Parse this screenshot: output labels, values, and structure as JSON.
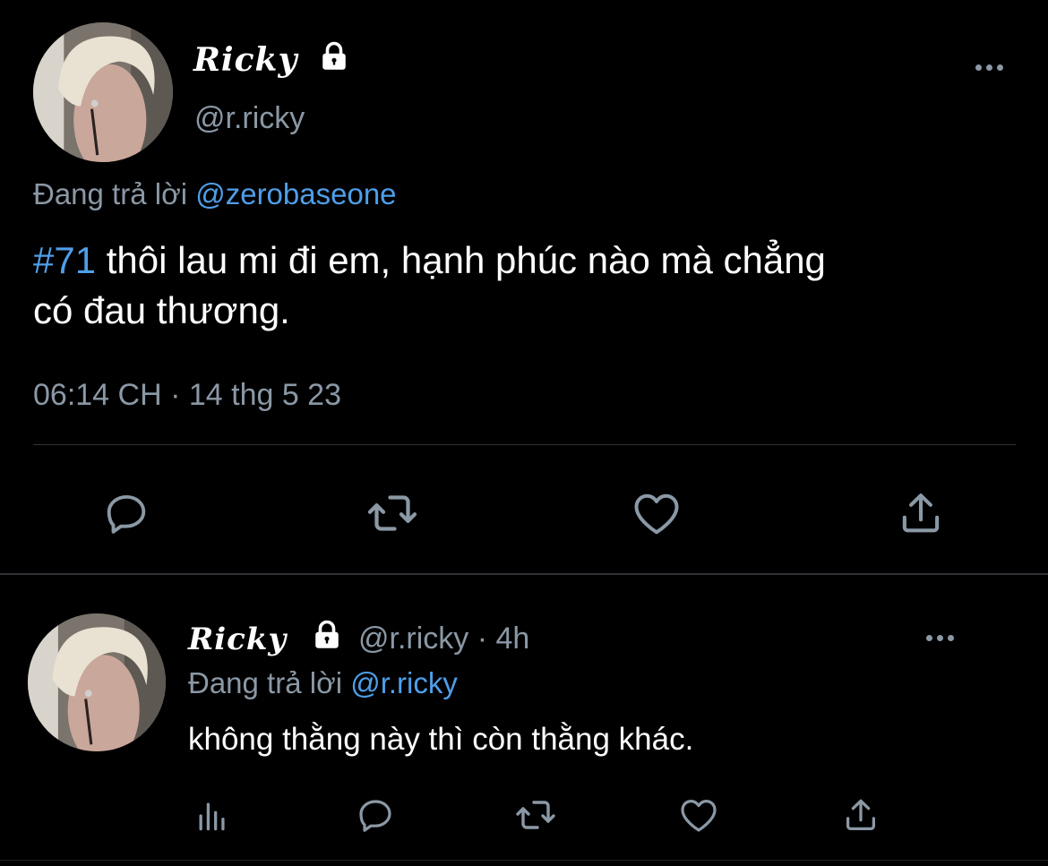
{
  "main_tweet": {
    "display_name": "Ricky",
    "handle": "@r.ricky",
    "replying_prefix": "Đang trả lời",
    "replying_to": "@zerobaseone",
    "hashtag": "#71",
    "text_line1": " thôi lau mi đi em, hạnh phúc nào mà chẳng",
    "text_line2": "có đau thương.",
    "timestamp": "06:14 CH · 14 thg 5 23"
  },
  "reply_tweet": {
    "display_name": "Ricky",
    "handle_time": "@r.ricky · 4h",
    "replying_prefix": "Đang trả lời",
    "replying_to": "@r.ricky",
    "text": "không thằng này thì còn thằng khác."
  },
  "icons": {
    "more": "more-horizontal-icon",
    "lock": "lock-icon",
    "reply": "reply-bubble-icon",
    "retweet": "retweet-icon",
    "like": "heart-icon",
    "share": "share-icon",
    "views": "analytics-bars-icon"
  },
  "colors": {
    "background": "#000000",
    "link": "#4f9ee8",
    "secondary_text": "#8b98a5",
    "icon": "#8b98a5",
    "divider": "#2f3336"
  }
}
